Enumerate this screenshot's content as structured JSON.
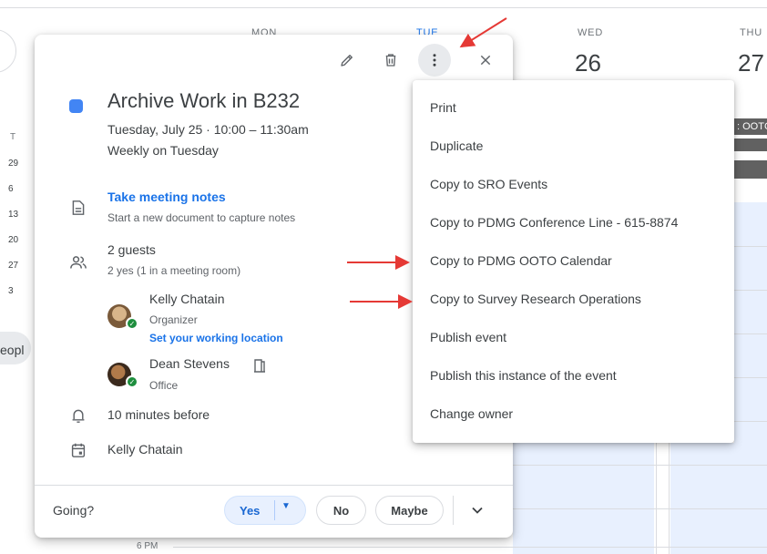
{
  "calendar": {
    "days": [
      {
        "name": "MON",
        "number": ""
      },
      {
        "name": "TUE",
        "number": ""
      },
      {
        "name": "WED",
        "number": "26"
      },
      {
        "name": "THU",
        "number": "27"
      }
    ],
    "mini_weekday": "T",
    "mini_dates": [
      "29",
      "6",
      "13",
      "20",
      "27",
      "3"
    ],
    "people_label": "eopl",
    "ooto_label": ": OOTC",
    "time_label": "6 PM"
  },
  "event": {
    "color": "#4285f4",
    "title": "Archive Work in B232",
    "datetime": "Tuesday, July 25  ·  10:00 – 11:30am",
    "recurrence": "Weekly on Tuesday",
    "notes_link": "Take meeting notes",
    "notes_sub": "Start a new document to capture notes",
    "guests_count": "2 guests",
    "guests_sub": "2 yes (1 in a meeting room)",
    "guests": [
      {
        "name": "Kelly Chatain",
        "role": "Organizer",
        "link": "Set your working location"
      },
      {
        "name": "Dean Stevens",
        "role": "Office"
      }
    ],
    "reminder": "10 minutes before",
    "calendar_owner": "Kelly Chatain"
  },
  "toolbar": {
    "edit_icon": "pencil-icon",
    "delete_icon": "trash-icon",
    "options_icon": "more-vert-icon",
    "close_icon": "close-icon"
  },
  "rsvp": {
    "prompt": "Going?",
    "yes": "Yes",
    "no": "No",
    "maybe": "Maybe"
  },
  "menu": {
    "items": [
      "Print",
      "Duplicate",
      "Copy to SRO Events",
      "Copy to PDMG Conference Line - 615-8874",
      "Copy to PDMG OOTO Calendar",
      "Copy to Survey Research Operations",
      "Publish event",
      "Publish this instance of the event",
      "Change owner"
    ]
  },
  "colors": {
    "accent": "#1a73e8",
    "annotation": "#e53935"
  }
}
